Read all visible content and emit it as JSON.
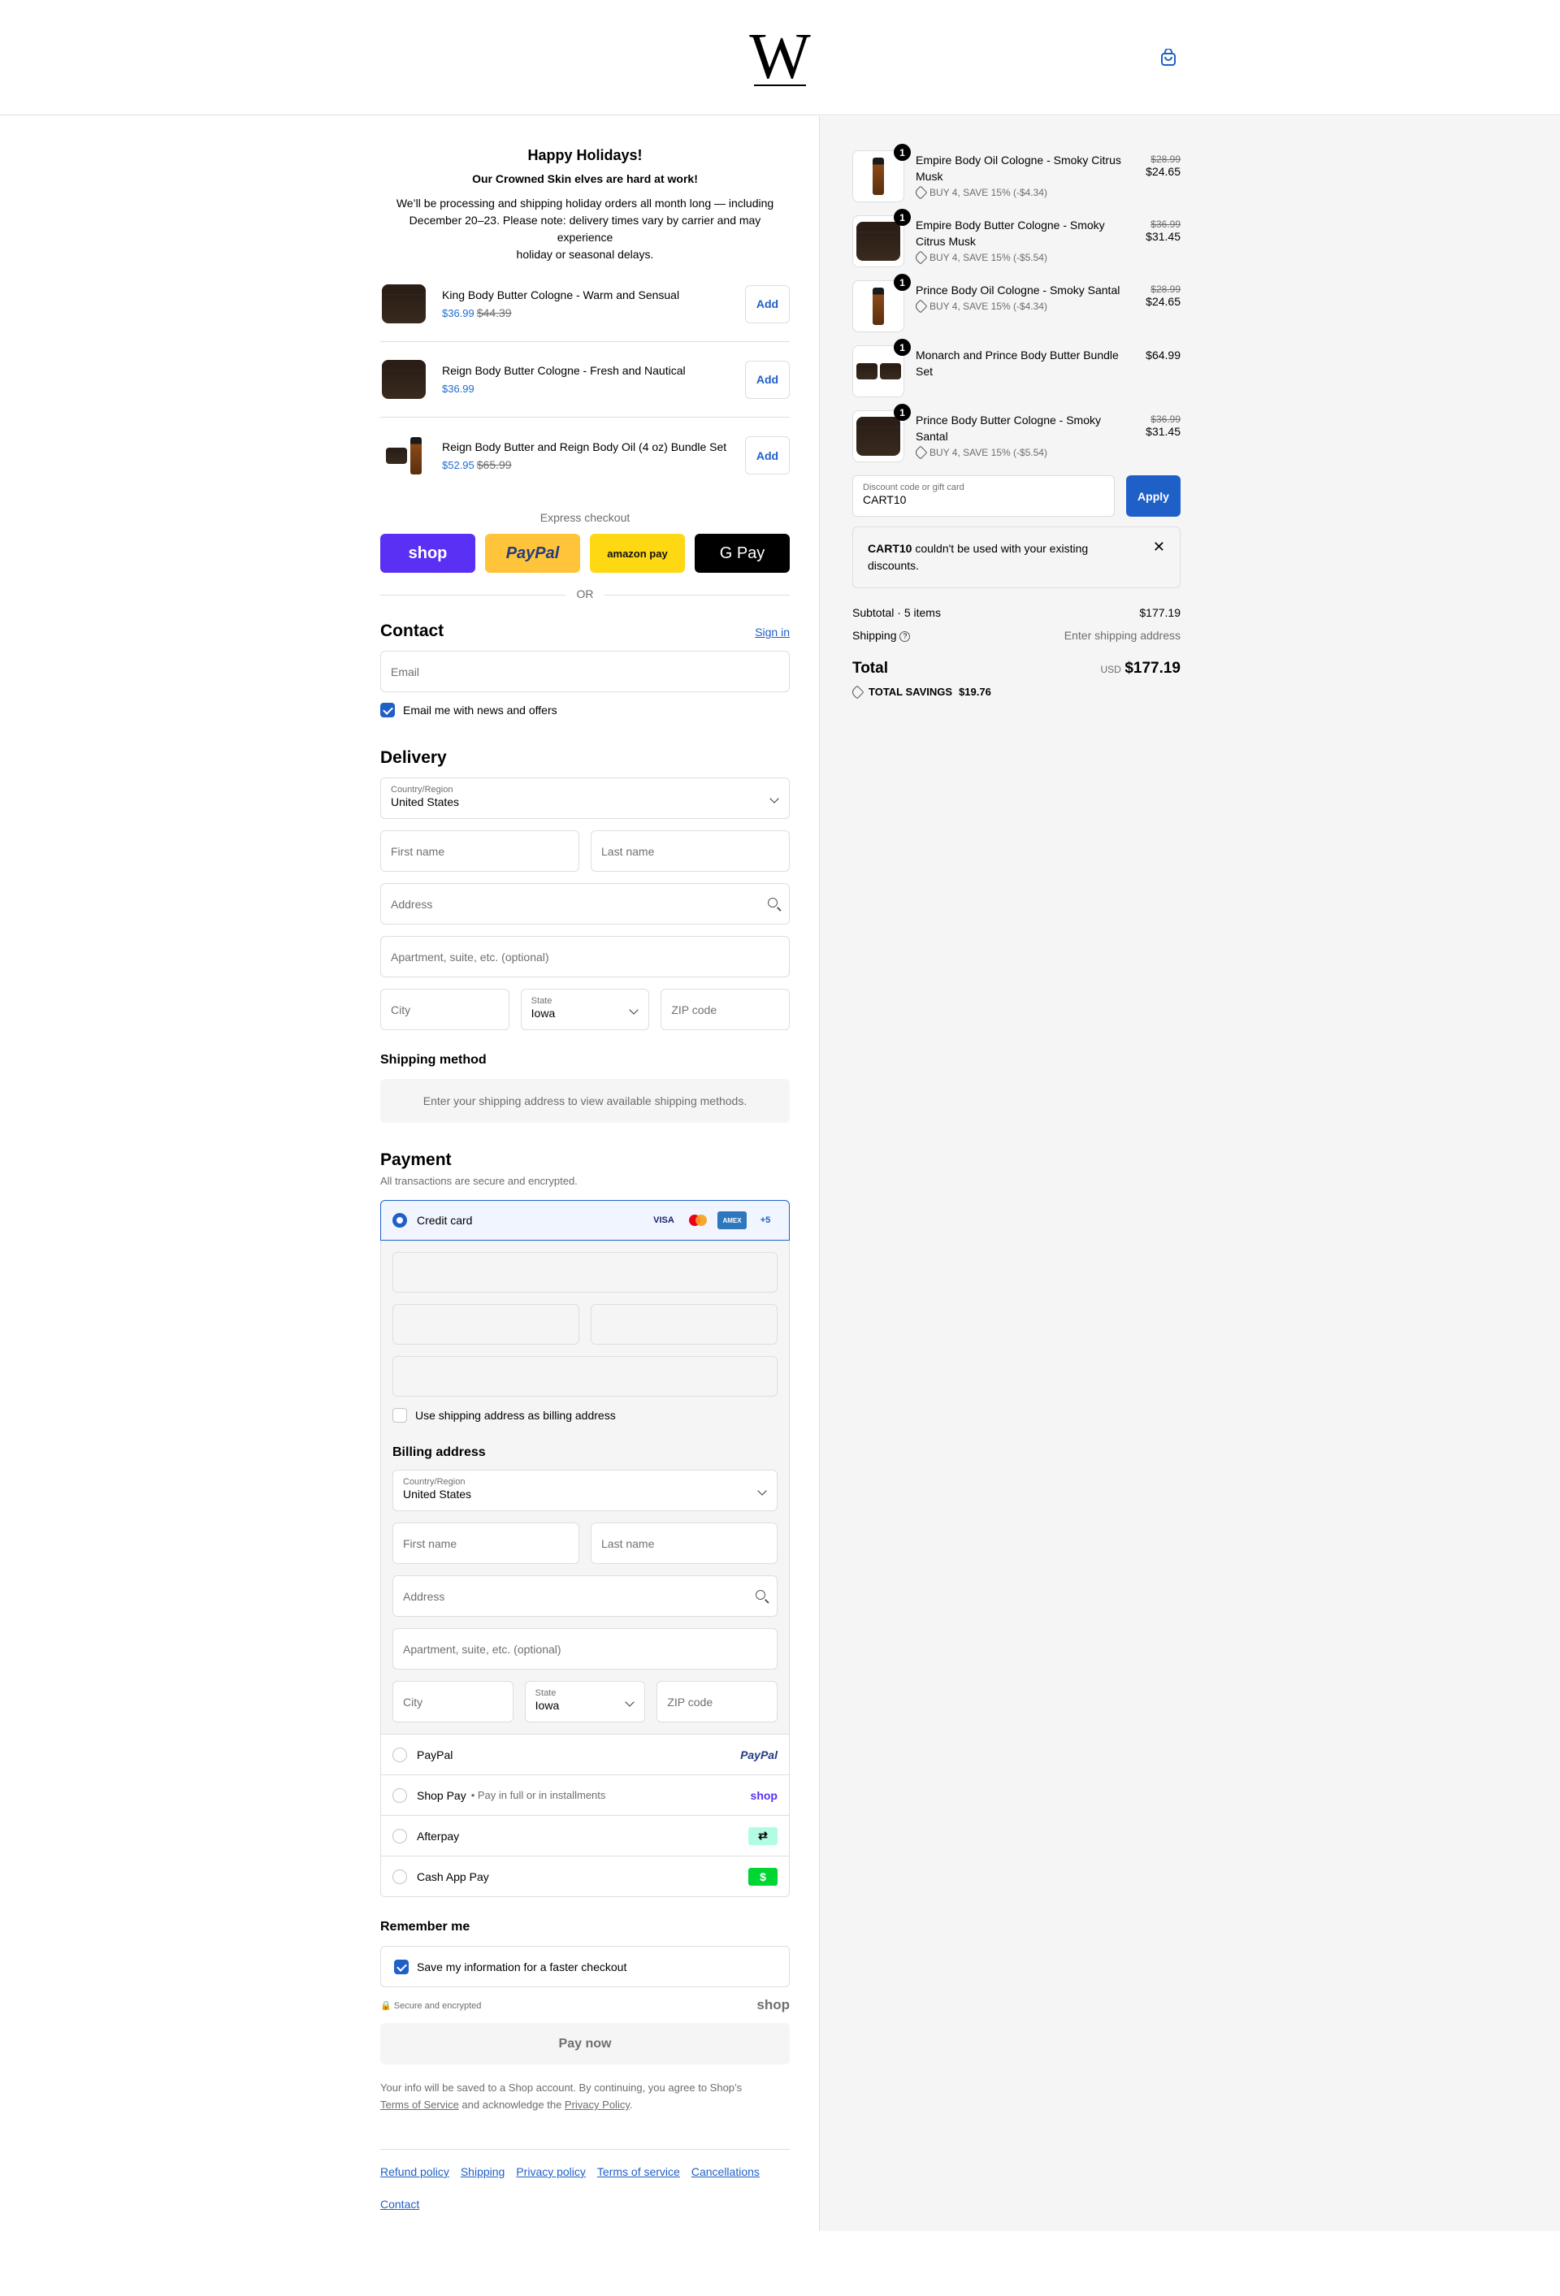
{
  "header": {
    "logo_letter": "W"
  },
  "holiday": {
    "title": "Happy Holidays!",
    "subtitle": "Our Crowned Skin elves are hard at work!",
    "line1": "We’ll be processing and shipping holiday orders all month long — including",
    "line2": "December 20–23. Please note: delivery times vary by carrier and may experience",
    "line3": "holiday or seasonal delays."
  },
  "upsells": [
    {
      "name": "King Body Butter Cologne - Warm and Sensual",
      "price": "$36.99",
      "old": "$44.39",
      "button": "Add"
    },
    {
      "name": "Reign Body Butter Cologne - Fresh and Nautical",
      "price": "$36.99",
      "old": "",
      "button": "Add"
    },
    {
      "name": "Reign Body Butter and Reign Body Oil (4 oz) Bundle Set",
      "price": "$52.95",
      "old": "$65.99",
      "button": "Add"
    }
  ],
  "express": {
    "label": "Express checkout",
    "shop": "shop",
    "paypal": "PayPal",
    "amazon": "amazon pay",
    "gpay": "G Pay",
    "or": "OR"
  },
  "contact": {
    "title": "Contact",
    "sign_in": "Sign in",
    "email_placeholder": "Email",
    "news_label": "Email me with news and offers"
  },
  "delivery": {
    "title": "Delivery",
    "country_label": "Country/Region",
    "country": "United States",
    "first": "First name",
    "last": "Last name",
    "address": "Address",
    "apt": "Apartment, suite, etc. (optional)",
    "city": "City",
    "state_label": "State",
    "state": "Iowa",
    "zip": "ZIP code"
  },
  "shipping": {
    "title": "Shipping method",
    "message": "Enter your shipping address to view available shipping methods."
  },
  "payment": {
    "title": "Payment",
    "subtitle": "All transactions are secure and encrypted.",
    "credit_card": "Credit card",
    "more_cards": "+5",
    "visa": "VISA",
    "amex": "AMEX",
    "billing_same": "Use shipping address as billing address",
    "billing_title": "Billing address",
    "paypal": "PayPal",
    "paypal_logo": "PayPal",
    "shoppay": "Shop Pay",
    "shoppay_note": "• Pay in full or in installments",
    "shoppay_logo": "shop",
    "afterpay": "Afterpay",
    "cashapp": "Cash App Pay",
    "cashapp_logo": "$"
  },
  "remember": {
    "title": "Remember me",
    "save": "Save my information for a faster checkout",
    "secure": "Secure and encrypted",
    "shop_logo": "shop"
  },
  "paynow": "Pay now",
  "legal": {
    "text1": "Your info will be saved to a Shop account. By continuing, you agree to Shop’s",
    "tos": "Terms of Service",
    "mid": " and acknowledge the ",
    "privacy": "Privacy Policy",
    "end": "."
  },
  "footer": [
    "Refund policy",
    "Shipping",
    "Privacy policy",
    "Terms of service",
    "Cancellations",
    "Contact"
  ],
  "cart": {
    "items": [
      {
        "qty": "1",
        "name": "Empire Body Oil Cologne - Smoky Citrus Musk",
        "discount": "BUY 4, SAVE 15% (-$4.34)",
        "old": "$28.99",
        "price": "$24.65",
        "kind": "bottle"
      },
      {
        "qty": "1",
        "name": "Empire Body Butter Cologne - Smoky Citrus Musk",
        "discount": "BUY 4, SAVE 15% (-$5.54)",
        "old": "$36.99",
        "price": "$31.45",
        "kind": "jar"
      },
      {
        "qty": "1",
        "name": "Prince Body Oil Cologne - Smoky Santal",
        "discount": "BUY 4, SAVE 15% (-$4.34)",
        "old": "$28.99",
        "price": "$24.65",
        "kind": "bottle"
      },
      {
        "qty": "1",
        "name": "Monarch and Prince Body Butter Bundle Set",
        "discount": "",
        "old": "",
        "price": "$64.99",
        "kind": "bundle"
      },
      {
        "qty": "1",
        "name": "Prince Body Butter Cologne - Smoky Santal",
        "discount": "BUY 4, SAVE 15% (-$5.54)",
        "old": "$36.99",
        "price": "$31.45",
        "kind": "jar"
      }
    ],
    "discount_label": "Discount code or gift card",
    "discount_value": "CART10",
    "apply": "Apply",
    "error_code": "CART10",
    "error_text": " couldn't be used with your existing discounts.",
    "subtotal_label": "Subtotal · 5 items",
    "subtotal": "$177.19",
    "shipping_label": "Shipping",
    "shipping_value": "Enter shipping address",
    "total_label": "Total",
    "currency": "USD",
    "total": "$177.19",
    "savings_label": "TOTAL SAVINGS",
    "savings": "$19.76"
  },
  "colors": {
    "accent": "#1f5fc8",
    "shop": "#5a31f4",
    "paypal": "#ffc439",
    "amazon": "#ffd814"
  }
}
